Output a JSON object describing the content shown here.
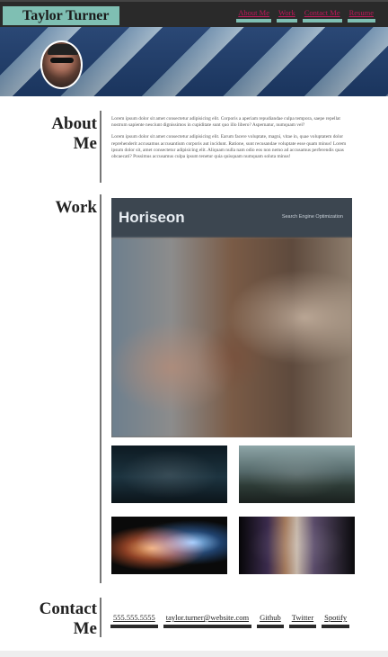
{
  "header": {
    "brand": "Taylor Turner",
    "nav": [
      "About Me",
      "Work",
      "Contact Me",
      "Resume"
    ]
  },
  "about": {
    "title_line1": "About",
    "title_line2": "Me",
    "paragraphs": [
      "Lorem ipsum dolor sit amet consectetur adipisicing elit. Corporis a aperiam repudiandae culpa tempora, saepe repellat nostrum sapiente nesciunt dignissimos in cupiditate sunt quo illo libero? Aspernatur, numquam vel?",
      "Lorem ipsum dolor sit amet consectetur adipisicing elit. Earum facere voluptate, magni, vitae in, quae voluptatem dolor reprehenderit accusamus accusantium corporis aut incidunt. Ratione, sunt recusandae voluptate esse quam minus! Lorem ipsum dolor sit, amet consectetur adipisicing elit. Aliquam nulla nam odio eos non nemo ad accusamus perferendis quas obcaecati? Possimus accusamus culpa ipsum tenetur quia quisquam numquam soluta minus!"
    ]
  },
  "work": {
    "title": "Work",
    "featured_logo": "Horiseon",
    "featured_subtitle": "Search Engine Optimization"
  },
  "contact": {
    "title_line1": "Contact",
    "title_line2": "Me",
    "links": [
      "555.555.5555",
      "taylor.turner@website.com",
      "Github",
      "Twitter",
      "Spotify"
    ]
  },
  "colors": {
    "accent_teal": "#7fbfb3",
    "header_dark": "#2a2a2a",
    "nav_link": "#c2185b"
  }
}
